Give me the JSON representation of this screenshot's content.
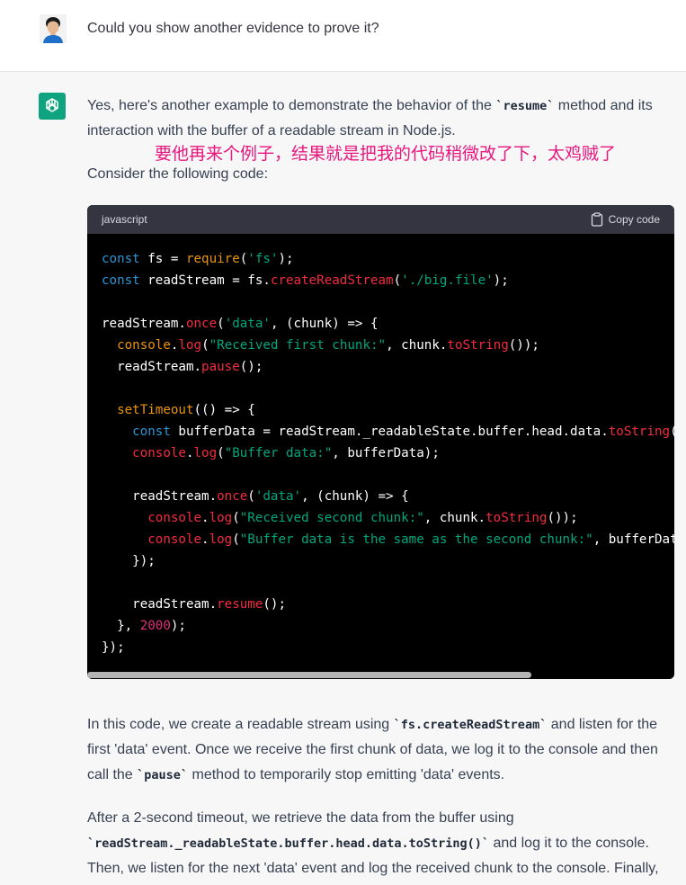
{
  "user": {
    "message": "Could you show another evidence to prove it?"
  },
  "assistant": {
    "intro_before_code": "Yes, here's another example to demonstrate the behavior of the ",
    "intro_code": "`resume`",
    "intro_after_code": " method and its interaction with the buffer of a readable stream in Node.js.",
    "annotation": "要他再来个例子，结果就是把我的代码稍微改了下，太鸡贼了",
    "consider": "Consider the following code:",
    "code_language": "javascript",
    "copy_label": "Copy code",
    "p1_a": "In this code, we create a readable stream using ",
    "p1_code1": "`fs.createReadStream`",
    "p1_b": " and listen for the first 'data' event. Once we receive the first chunk of data, we log it to the console and then call the ",
    "p1_code2": "`pause`",
    "p1_c": " method to temporarily stop emitting 'data' events.",
    "p2_a": "After a 2-second timeout, we retrieve the data from the buffer using ",
    "p2_code": "`readStream._readableState.buffer.head.data.toString()`",
    "p2_b": " and log it to the console. Then, we listen for the next 'data' event and log the received chunk to the console. Finally,"
  },
  "code": {
    "l1_kw": "const",
    "l1_a": " fs = ",
    "l1_req": "require",
    "l1_b": "(",
    "l1_str": "'fs'",
    "l1_c": ");",
    "l2_kw": "const",
    "l2_a": " readStream = fs.",
    "l2_fn": "createReadStream",
    "l2_b": "(",
    "l2_str": "'./big.file'",
    "l2_c": ");",
    "l4_a": "readStream.",
    "l4_fn": "once",
    "l4_b": "(",
    "l4_str": "'data'",
    "l4_c": ", (chunk) => {",
    "l5_a": "  ",
    "l5_fn1": "console",
    "l5_b": ".",
    "l5_fn2": "log",
    "l5_c": "(",
    "l5_str": "\"Received first chunk:\"",
    "l5_d": ", chunk.",
    "l5_fn3": "toString",
    "l5_e": "());",
    "l6_a": "  readStream.",
    "l6_fn": "pause",
    "l6_b": "();",
    "l8_a": "  ",
    "l8_bi": "setTimeout",
    "l8_b": "(() => {",
    "l9_a": "    ",
    "l9_kw": "const",
    "l9_b": " bufferData = readStream._readableState.buffer.head.data.",
    "l9_fn": "toString",
    "l9_c": "();",
    "l10_a": "    ",
    "l10_fn1": "console",
    "l10_b": ".",
    "l10_fn2": "log",
    "l10_c": "(",
    "l10_str": "\"Buffer data:\"",
    "l10_d": ", bufferData);",
    "l12_a": "    readStream.",
    "l12_fn": "once",
    "l12_b": "(",
    "l12_str": "'data'",
    "l12_c": ", (chunk) => {",
    "l13_a": "      ",
    "l13_fn1": "console",
    "l13_b": ".",
    "l13_fn2": "log",
    "l13_c": "(",
    "l13_str": "\"Received second chunk:\"",
    "l13_d": ", chunk.",
    "l13_fn3": "toString",
    "l13_e": "());",
    "l14_a": "      ",
    "l14_fn1": "console",
    "l14_b": ".",
    "l14_fn2": "log",
    "l14_c": "(",
    "l14_str": "\"Buffer data is the same as the second chunk:\"",
    "l14_d": ", bufferData",
    "l15": "    });",
    "l17_a": "    readStream.",
    "l17_fn": "resume",
    "l17_b": "();",
    "l18_a": "  }, ",
    "l18_num": "2000",
    "l18_b": ");",
    "l19": "});"
  },
  "colors": {
    "accent": "#10a37f",
    "annotation": "#e8177e"
  },
  "icons": {
    "assistant_logo": "openai-logo-icon",
    "copy": "clipboard-icon"
  }
}
